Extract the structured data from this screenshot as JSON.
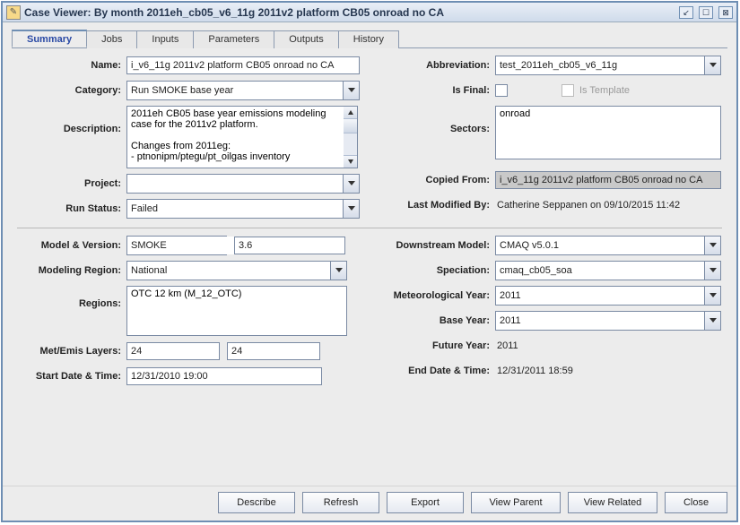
{
  "window": {
    "title": "Case Viewer: By month 2011eh_cb05_v6_11g 2011v2 platform CB05 onroad no CA"
  },
  "tabs": [
    "Summary",
    "Jobs",
    "Inputs",
    "Parameters",
    "Outputs",
    "History"
  ],
  "labels": {
    "name": "Name:",
    "category": "Category:",
    "description": "Description:",
    "project": "Project:",
    "run_status": "Run Status:",
    "abbreviation": "Abbreviation:",
    "is_final": "Is Final:",
    "is_template": "Is Template",
    "sectors": "Sectors:",
    "copied_from": "Copied From:",
    "last_modified_by": "Last Modified By:",
    "model_version": "Model & Version:",
    "modeling_region": "Modeling Region:",
    "regions": "Regions:",
    "met_emis_layers": "Met/Emis Layers:",
    "start_datetime": "Start Date & Time:",
    "downstream_model": "Downstream Model:",
    "speciation": "Speciation:",
    "met_year": "Meteorological Year:",
    "base_year": "Base Year:",
    "future_year": "Future Year:",
    "end_datetime": "End Date & Time:"
  },
  "values": {
    "name": "i_v6_11g 2011v2 platform CB05 onroad no CA",
    "category": "Run SMOKE base year",
    "description": "2011eh CB05 base year emissions modeling case for the 2011v2 platform.\n\nChanges from 2011eg:\n- ptnonipm/ptegu/pt_oilgas inventory",
    "project": "",
    "run_status": "Failed",
    "abbreviation": "test_2011eh_cb05_v6_11g",
    "sectors": "onroad",
    "copied_from": "i_v6_11g 2011v2 platform CB05 onroad no CA",
    "last_modified_by": "Catherine Seppanen on 09/10/2015 11:42",
    "model": "SMOKE",
    "version": "3.6",
    "modeling_region": "National",
    "regions": "OTC 12 km (M_12_OTC)",
    "met_layers": "24",
    "emis_layers": "24",
    "start_datetime": "12/31/2010 19:00",
    "downstream_model": "CMAQ v5.0.1",
    "speciation": "cmaq_cb05_soa",
    "met_year": "2011",
    "base_year": "2011",
    "future_year": "2011",
    "end_datetime": "12/31/2011 18:59"
  },
  "buttons": {
    "describe": "Describe",
    "refresh": "Refresh",
    "export": "Export",
    "view_parent": "View Parent",
    "view_related": "View Related",
    "close": "Close"
  }
}
